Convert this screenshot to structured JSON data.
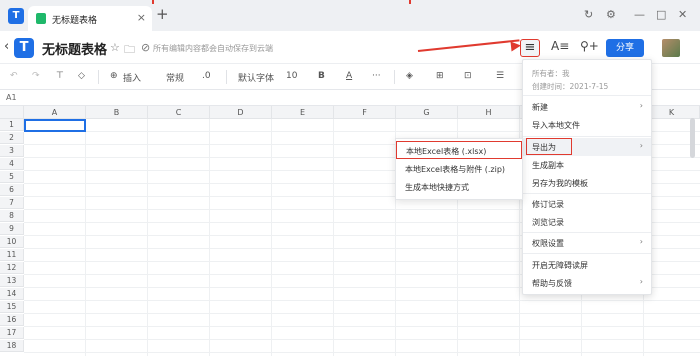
{
  "tab": {
    "title": "无标题表格",
    "new_tab": "+"
  },
  "header": {
    "title": "无标题表格",
    "save_status": "所有编辑内容都会自动保存到云端",
    "share_label": "分享"
  },
  "toolbar": {
    "insert": "插入",
    "format_general": "常规",
    "decimal": ".0",
    "font": "默认字体",
    "font_size": "10"
  },
  "formula": {
    "cell_ref": "A1"
  },
  "columns": [
    "A",
    "B",
    "C",
    "D",
    "E",
    "F",
    "G",
    "H",
    "I",
    "J",
    "K"
  ],
  "rows": [
    "1",
    "2",
    "3",
    "4",
    "5",
    "6",
    "7",
    "8",
    "9",
    "10",
    "11",
    "12",
    "13",
    "14",
    "15",
    "16",
    "17",
    "18"
  ],
  "menu": {
    "owner": "所有者：我",
    "created": "创建时间：2021-7-15",
    "items": [
      {
        "label": "新建",
        "arrow": "›"
      },
      {
        "label": "导入本地文件",
        "arrow": ""
      },
      {
        "label": "导出为",
        "arrow": "›"
      },
      {
        "label": "生成副本",
        "arrow": ""
      },
      {
        "label": "另存为我的模板",
        "arrow": ""
      },
      {
        "label": "修订记录",
        "arrow": ""
      },
      {
        "label": "浏览记录",
        "arrow": ""
      },
      {
        "label": "权限设置",
        "arrow": "›"
      },
      {
        "label": "开启无障碍读屏",
        "arrow": ""
      },
      {
        "label": "帮助与反馈",
        "arrow": "›"
      }
    ]
  },
  "submenu": {
    "items": [
      {
        "label": "本地Excel表格 (.xlsx)"
      },
      {
        "label": "本地Excel表格与附件 (.zip)"
      },
      {
        "label": "生成本地快捷方式"
      }
    ]
  },
  "colors": {
    "accent": "#1f6fe5",
    "highlight_red": "#e03a2f"
  }
}
